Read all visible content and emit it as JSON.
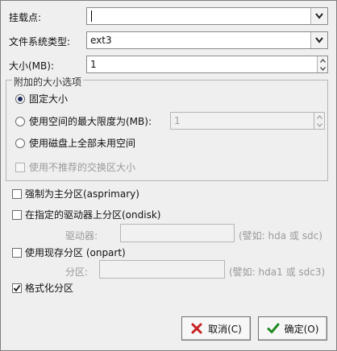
{
  "mount_point": {
    "label": "挂载点:",
    "value": ""
  },
  "filesystem": {
    "label": "文件系统类型:",
    "value": "ext3"
  },
  "size": {
    "label": "大小(MB):",
    "value": "1"
  },
  "size_options": {
    "title": "附加的大小选项",
    "fixed": {
      "label": "固定大小",
      "selected": true
    },
    "max": {
      "label": "使用空间的最大限度为(MB):",
      "value": "1",
      "selected": false
    },
    "fill": {
      "label": "使用磁盘上全部未用空间",
      "selected": false
    },
    "swap": {
      "label": "使用不推荐的交换区大小",
      "checked": false
    }
  },
  "asprimary": {
    "label": "强制为主分区(asprimary)",
    "checked": false
  },
  "ondisk": {
    "label": "在指定的驱动器上分区(ondisk)",
    "checked": false,
    "field_label": "驱动器:",
    "value": "",
    "hint": "(譬如: hda 或 sdc)"
  },
  "onpart": {
    "label": "使用现存分区 (onpart)",
    "checked": false,
    "field_label": "分区:",
    "value": "",
    "hint": "(譬如: hda1 或 sdc3)"
  },
  "format": {
    "label": "格式化分区",
    "checked": true
  },
  "buttons": {
    "cancel": "取消(C)",
    "ok": "确定(O)"
  },
  "icons": {
    "combo": "chevron-down-icon",
    "spin_up": "spin-up-icon",
    "spin_down": "spin-down-icon",
    "cancel": "close-icon",
    "ok": "check-icon"
  },
  "colors": {
    "cancel_icon": "#c82020",
    "ok_icon": "#1f8a1f",
    "check": "#1a1a1a"
  }
}
